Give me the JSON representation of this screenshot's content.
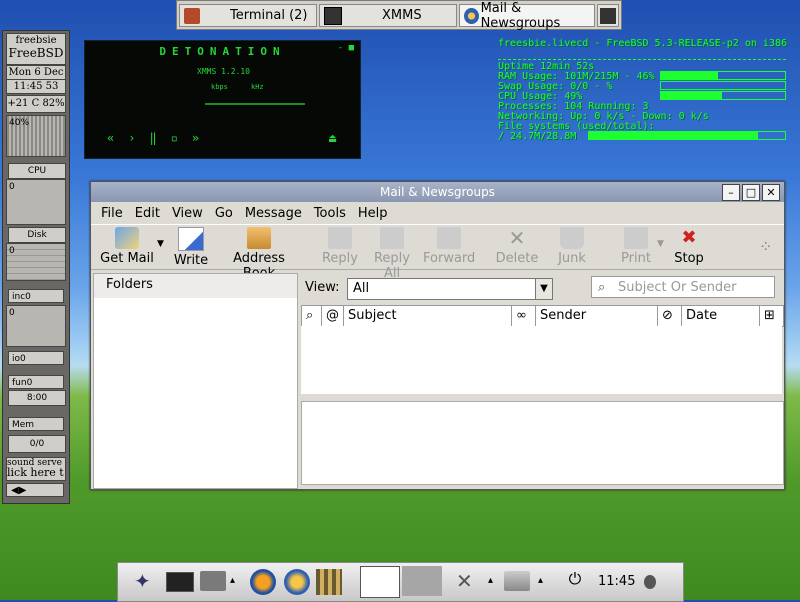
{
  "taskbar": {
    "items": [
      {
        "label": "Terminal (2)",
        "icon": "terminal-icon"
      },
      {
        "label": "XMMS",
        "icon": "xmms-icon"
      },
      {
        "label": "Mail & Newsgroups",
        "icon": "mail-icon"
      }
    ]
  },
  "gkrellm": {
    "host": "freebsie",
    "os": "FreeBSD",
    "date": "Mon  6 Dec",
    "time": "11:45 53",
    "temp": "+21 C",
    "battery": "82%",
    "cpu_percent": "40%",
    "cpu_label": "CPU",
    "disk_label": "Disk",
    "inc_label": "inc0",
    "io_label": "io0",
    "fun_label": "fun0",
    "fun_time": "8:00",
    "mem_label": "Mem",
    "mail_count": "0/0",
    "zero": "0",
    "ticker": "sound serve",
    "ticker2": "lick here t"
  },
  "xmms": {
    "title": "DETONATION",
    "version": "XMMS 1.2.10",
    "kbps": "kbps",
    "khz": "kHz"
  },
  "sysinfo": {
    "header": "freesbie.livecd - FreeBSD 5.3-RELEASE-p2 on i386",
    "uptime": "Uptime 12min 52s",
    "ram": "RAM Usage: 101M/215M - 46%",
    "ram_pct": 46,
    "swap": "Swap Usage: 0/0 - %",
    "swap_pct": 0,
    "cpu": "CPU Usage: 49%",
    "cpu_pct": 49,
    "processes": "Processes: 104  Running: 3",
    "net": "Networking: Up: 0 k/s - Down: 0 k/s",
    "fs_label": "File systems (used/total):",
    "fs": " / 24.7M/28.8M",
    "fs_pct": 86
  },
  "mail": {
    "title": "Mail & Newsgroups",
    "menu": [
      "File",
      "Edit",
      "View",
      "Go",
      "Message",
      "Tools",
      "Help"
    ],
    "toolbar": {
      "get_mail": "Get Mail",
      "write": "Write",
      "address_book": "Address Book",
      "reply": "Reply",
      "reply_all": "Reply All",
      "forward": "Forward",
      "delete": "Delete",
      "junk": "Junk",
      "print": "Print",
      "stop": "Stop"
    },
    "folders_header": "Folders",
    "view_label": "View:",
    "view_value": "All",
    "search_placeholder": "Subject Or Sender",
    "columns": {
      "subject": "Subject",
      "sender": "Sender",
      "date": "Date"
    }
  },
  "dock": {
    "time": "11:45"
  }
}
